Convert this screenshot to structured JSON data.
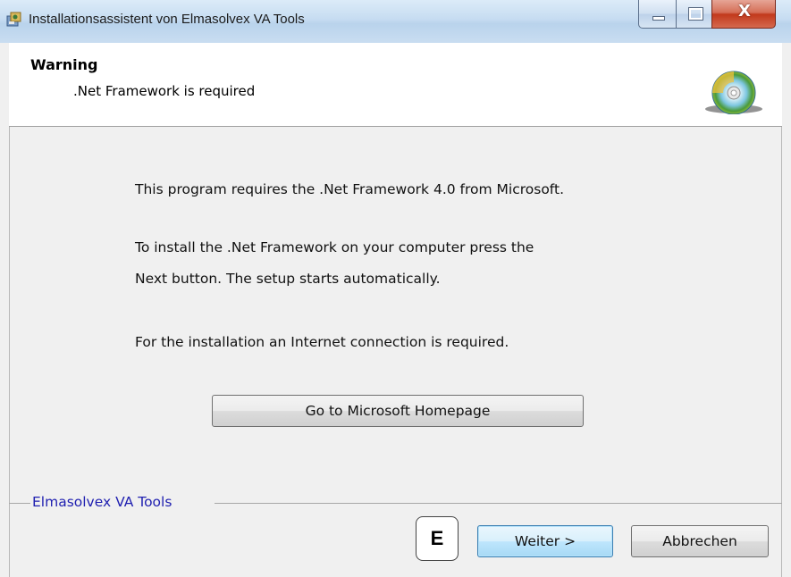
{
  "window": {
    "title": "Installationsassistent von Elmasolvex VA Tools",
    "controls": {
      "minimize": "minimize",
      "maximize": "maximize",
      "close": "X"
    }
  },
  "header": {
    "title": "Warning",
    "subtitle": ".Net Framework is required",
    "icon": "cd-icon"
  },
  "body": {
    "line1": "This program requires the .Net Framework 4.0 from Microsoft.",
    "line2": "To install the .Net Framework on your computer press the",
    "line3": "Next button. The setup starts automatically.",
    "line4": "For the installation an Internet connection is required.",
    "homepage_button": "Go to Microsoft Homepage"
  },
  "footer": {
    "group_label": "Elmasolvex VA Tools",
    "badge": "E",
    "next_button": "Weiter >",
    "cancel_button": "Abbrechen"
  }
}
